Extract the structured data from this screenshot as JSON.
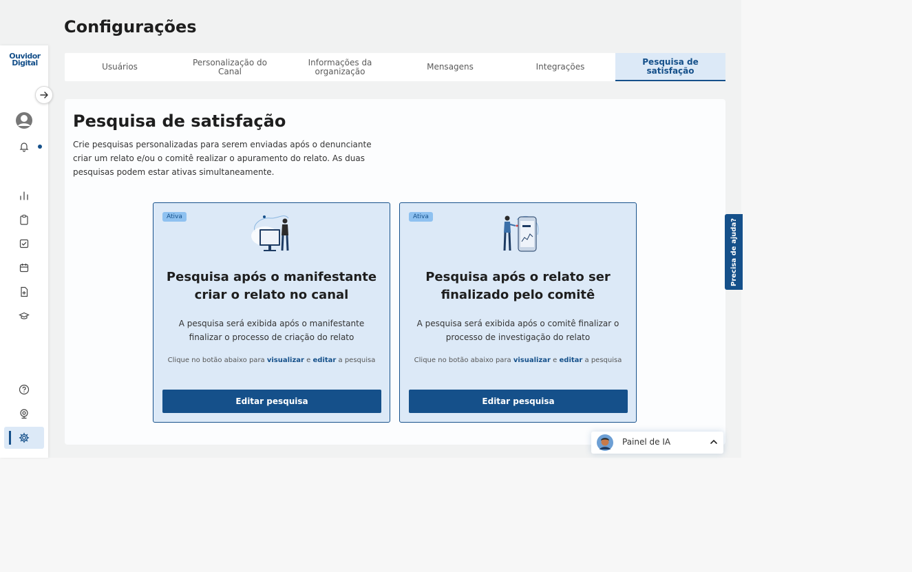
{
  "app": {
    "logo_line1": "Ouvidor",
    "logo_line2": "Digital",
    "page_title": "Configurações"
  },
  "tabs": [
    {
      "label": "Usuários",
      "active": false
    },
    {
      "label": "Personalização do Canal",
      "active": false
    },
    {
      "label": "Informações da organização",
      "active": false
    },
    {
      "label": "Mensagens",
      "active": false
    },
    {
      "label": "Integrações",
      "active": false
    },
    {
      "label": "Pesquisa de satisfação",
      "active": true
    }
  ],
  "panel": {
    "title": "Pesquisa de satisfação",
    "description": "Crie pesquisas personalizadas para serem enviadas após o denunciante criar um relato e/ou o comitê realizar o apuramento do relato. As duas pesquisas podem estar ativas simultaneamente."
  },
  "cards": [
    {
      "badge": "Ativa",
      "title": "Pesquisa após o manifestante criar o relato no canal",
      "description": "A pesquisa será exibida após o manifestante finalizar o processo de criação do relato",
      "hint_pre": "Clique no botão abaixo para ",
      "hint_view": "visualizar",
      "hint_mid": " e ",
      "hint_edit": "editar",
      "hint_post": " a pesquisa",
      "button": "Editar pesquisa"
    },
    {
      "badge": "Ativa",
      "title": "Pesquisa após o relato ser finalizado pelo comitê",
      "description": "A pesquisa será exibida após o comitê finalizar o processo de investigação do relato",
      "hint_pre": "Clique no botão abaixo para ",
      "hint_view": "visualizar",
      "hint_mid": " e ",
      "hint_edit": "editar",
      "hint_post": " a pesquisa",
      "button": "Editar pesquisa"
    }
  ],
  "help_tab": "Precisa de ajuda?",
  "ai_panel": {
    "label": "Painel de IA"
  },
  "sidebar_icons": [
    "arrow-right-icon",
    "user-avatar-icon",
    "bell-icon",
    "chart-icon",
    "clipboard-icon",
    "checkbox-icon",
    "calendar-icon",
    "file-plus-icon",
    "graduation-cap-icon",
    "help-circle-icon",
    "webcam-icon",
    "gear-icon"
  ],
  "colors": {
    "primary": "#15508a",
    "active_bg": "#dce9f7",
    "badge": "#8ec1f0"
  }
}
